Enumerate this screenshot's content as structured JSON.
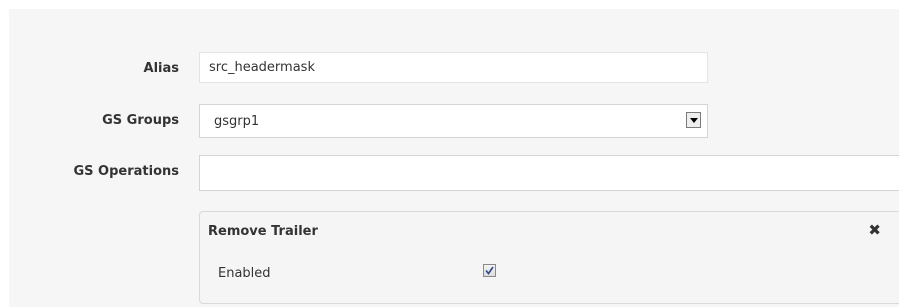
{
  "form": {
    "alias": {
      "label": "Alias",
      "value": "src_headermask"
    },
    "gs_groups": {
      "label": "GS Groups",
      "selected": "gsgrp1"
    },
    "gs_operations": {
      "label": "GS Operations",
      "value": ""
    }
  },
  "operation": {
    "title": "Remove Trailer",
    "close_symbol": "✖",
    "enabled_label": "Enabled",
    "enabled": true
  },
  "icons": {
    "close": "close-icon",
    "dropdown": "dropdown-arrow-icon",
    "check": "checkmark-icon"
  },
  "colors": {
    "panel_bg": "#f6f6f6",
    "label_text": "#333333",
    "check_color": "#2b4a8b"
  }
}
